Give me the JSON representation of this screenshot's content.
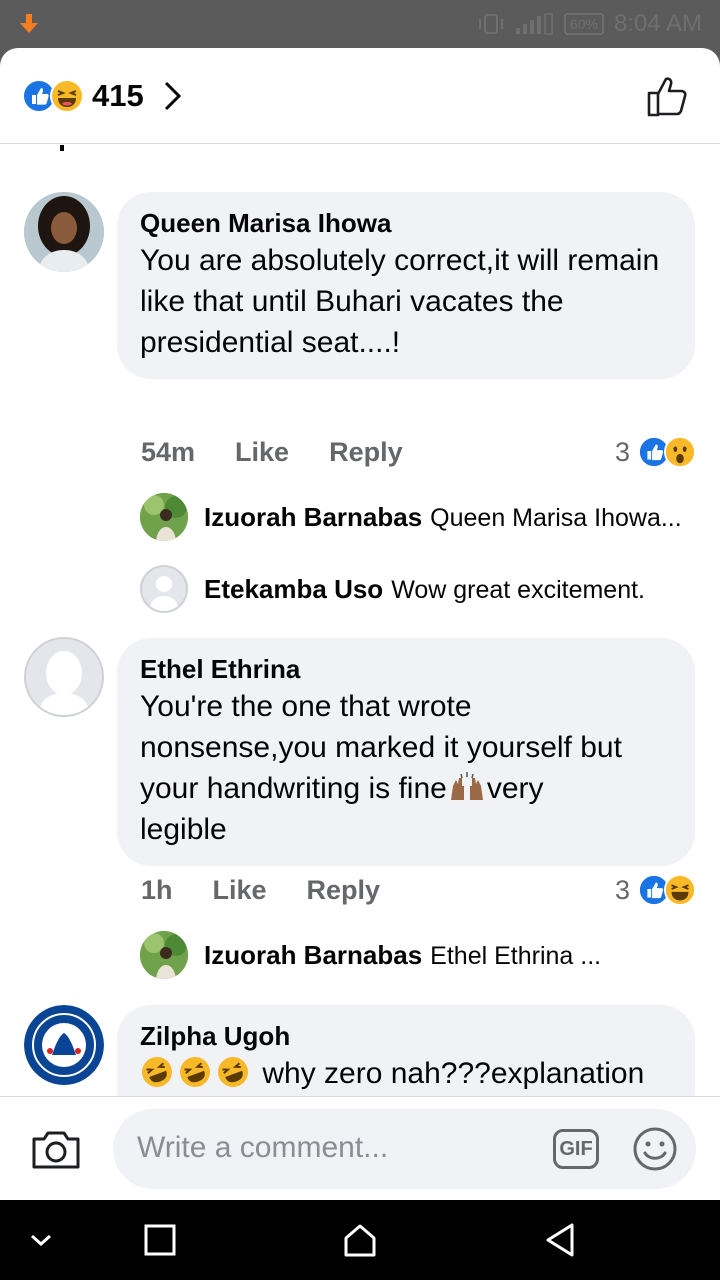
{
  "status_bar": {
    "time": "8:04 AM",
    "battery": "60%"
  },
  "header": {
    "reaction_count": "415"
  },
  "comments": [
    {
      "author": "Queen Marisa Ihowa",
      "text": "You are absolutely correct,it will remain like that until Buhari vacates the presidential seat....!",
      "time": "54m",
      "like": "Like",
      "reply": "Reply",
      "reaction_count": "3",
      "replies": [
        {
          "author": "Izuorah Barnabas",
          "text": "Queen Marisa Ihowa..."
        },
        {
          "author": "Etekamba Uso",
          "text": "Wow great excitement."
        }
      ]
    },
    {
      "author": "Ethel Ethrina",
      "text_line1": "You're the one that wrote",
      "text_line2": "nonsense,you marked it yourself but",
      "text_line3a": "your handwriting is fine",
      "text_line3b": "very",
      "text_line4": "legible",
      "time": "1h",
      "like": "Like",
      "reply": "Reply",
      "reaction_count": "3",
      "replies": [
        {
          "author": "Izuorah Barnabas",
          "text": "Ethel Ethrina ..."
        }
      ]
    },
    {
      "author": "Zilpha Ugoh",
      "text": "why zero nah???explanation is explanation depend on how you go"
    }
  ],
  "composer": {
    "placeholder": "Write a comment...",
    "gif_label": "GIF"
  }
}
